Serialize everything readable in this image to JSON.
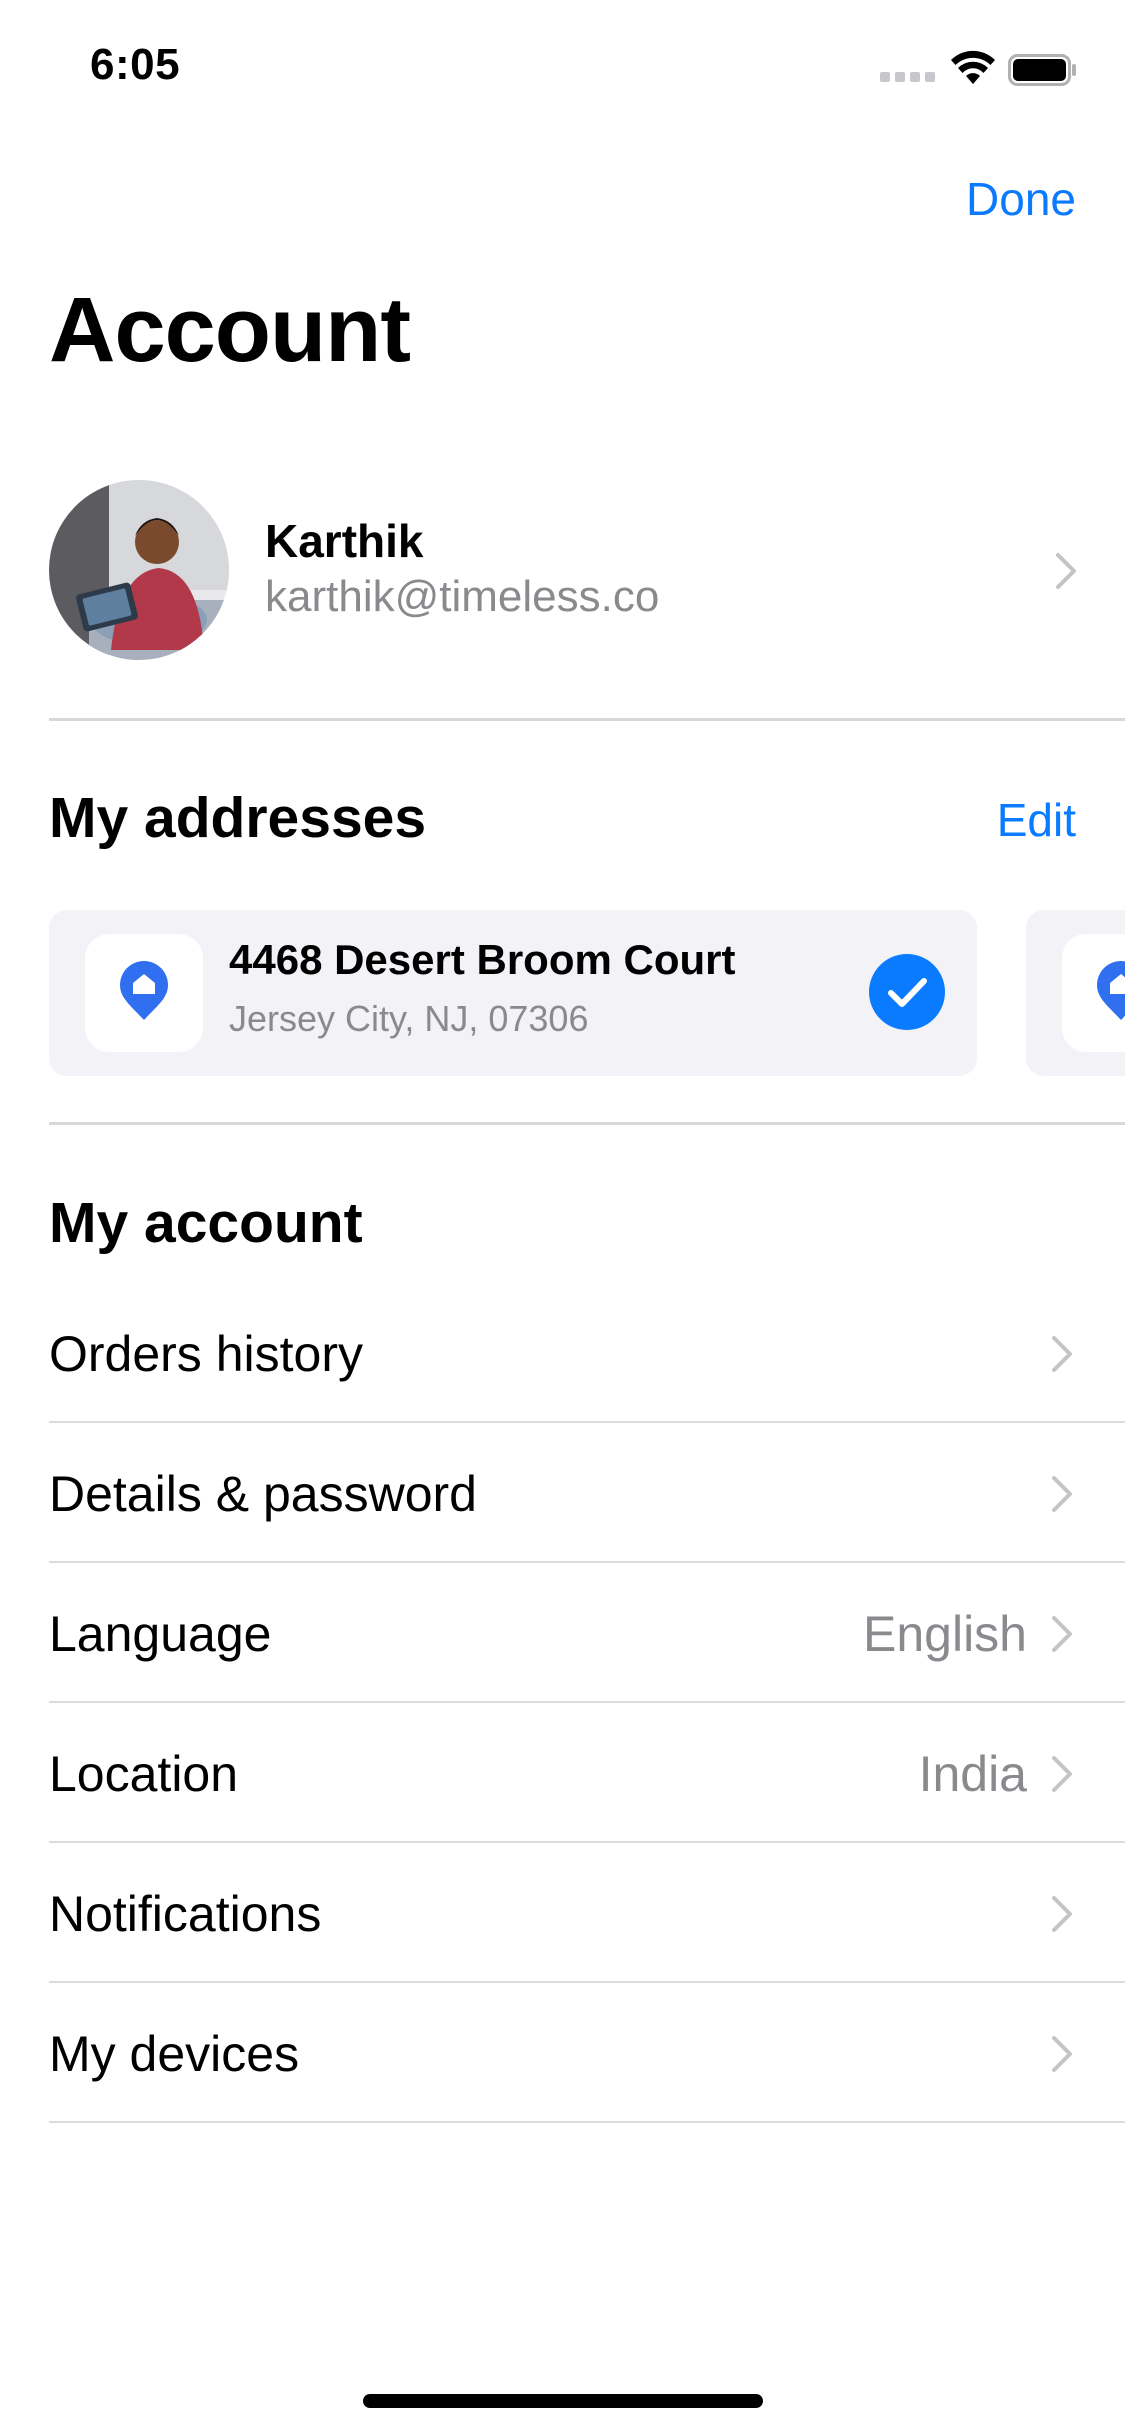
{
  "status_bar": {
    "time": "6:05"
  },
  "nav": {
    "done_label": "Done"
  },
  "title": "Account",
  "profile": {
    "name": "Karthik",
    "email": "karthik@timeless.co"
  },
  "addresses": {
    "title": "My addresses",
    "edit_label": "Edit",
    "cards": [
      {
        "title": "4468 Desert Broom Court",
        "subtitle": "Jersey City, NJ, 07306",
        "selected": true
      }
    ]
  },
  "account": {
    "title": "My account",
    "items": [
      {
        "label": "Orders history",
        "value": ""
      },
      {
        "label": "Details & password",
        "value": ""
      },
      {
        "label": "Language",
        "value": "English"
      },
      {
        "label": "Location",
        "value": "India"
      },
      {
        "label": "Notifications",
        "value": ""
      },
      {
        "label": "My devices",
        "value": ""
      }
    ]
  },
  "colors": {
    "accent": "#0a7aff",
    "secondary_text": "#8a8a8e",
    "card_bg": "#f2f2f7"
  }
}
